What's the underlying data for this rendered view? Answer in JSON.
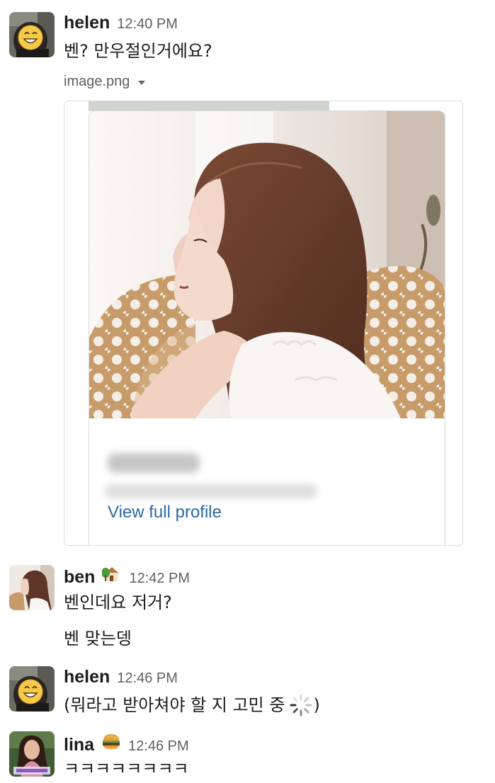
{
  "messages": [
    {
      "user": "helen",
      "time": "12:40 PM",
      "text": "벤? 만우절인거에요?",
      "attachment": {
        "filename": "image.png",
        "link_label": "View full profile"
      }
    },
    {
      "user": "ben",
      "status_icon": "house-with-garden-icon",
      "time": "12:42 PM",
      "lines": [
        "벤인데요 저거?",
        "벤 맞는뎅"
      ]
    },
    {
      "user": "helen",
      "time": "12:46 PM",
      "text": "(뭐라고 받아쳐야 할 지 고민 중",
      "text_after_icon": ")",
      "inline_icon": "loading-spinner-icon"
    },
    {
      "user": "lina",
      "status_icon": "hamburger-icon",
      "time": "12:46 PM",
      "text": "ㅋㅋㅋㅋㅋㅋㅋㅋ"
    }
  ],
  "colors": {
    "name": "#1d1c1d",
    "timestamp": "#616061",
    "link": "#2d6aa7",
    "border": "#dddddd"
  }
}
